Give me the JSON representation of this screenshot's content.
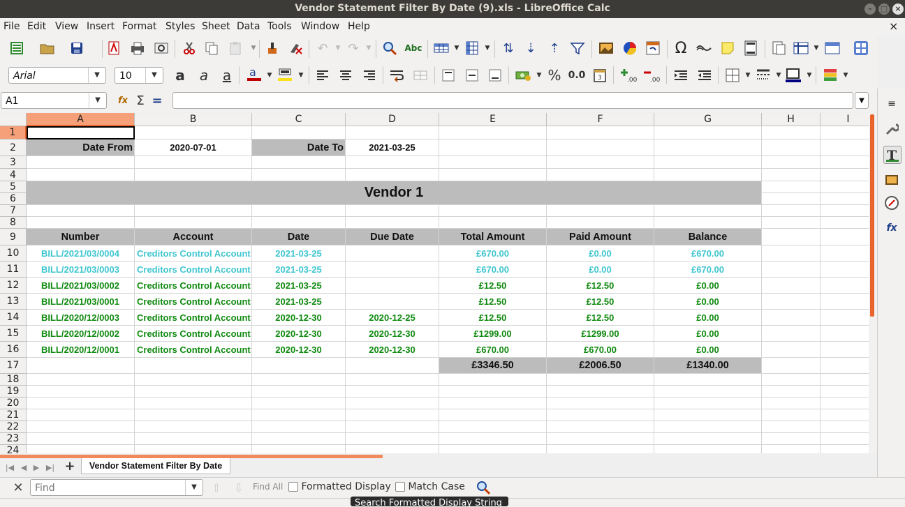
{
  "window": {
    "title": "Vendor Statement Filter By Date (9).xls - LibreOffice Calc",
    "close_glyph": "×"
  },
  "menu": [
    "File",
    "Edit",
    "View",
    "Insert",
    "Format",
    "Styles",
    "Sheet",
    "Data",
    "Tools",
    "Window",
    "Help"
  ],
  "format_bar": {
    "font_name": "Arial",
    "font_size": "10",
    "percent": "%",
    "decimal": "0.0"
  },
  "formula_bar": {
    "name_box": "A1",
    "formula": ""
  },
  "columns": [
    {
      "label": "A"
    },
    {
      "label": "B"
    },
    {
      "label": "C"
    },
    {
      "label": "D"
    },
    {
      "label": "E"
    },
    {
      "label": "F"
    },
    {
      "label": "G"
    },
    {
      "label": "H"
    },
    {
      "label": "I"
    }
  ],
  "rows": [
    "1",
    "2",
    "3",
    "4",
    "5",
    "6",
    "7",
    "8",
    "9",
    "10",
    "11",
    "12",
    "13",
    "14",
    "15",
    "16",
    "17",
    "18",
    "19",
    "20",
    "21",
    "22",
    "23",
    "24"
  ],
  "sheet": {
    "date_from_label": "Date From",
    "date_from": "2020-07-01",
    "date_to_label": "Date To",
    "date_to": "2021-03-25",
    "vendor": "Vendor 1",
    "headers": [
      "Number",
      "Account",
      "Date",
      "Due Date",
      "Total Amount",
      "Paid Amount",
      "Balance"
    ],
    "records": [
      {
        "number": "BILL/2021/03/0004",
        "account": "Creditors Control Account",
        "date": "2021-03-25",
        "due": "",
        "total": "£670.00",
        "paid": "£0.00",
        "balance": "£670.00",
        "color": "#3fc6d0"
      },
      {
        "number": "BILL/2021/03/0003",
        "account": "Creditors Control Account",
        "date": "2021-03-25",
        "due": "",
        "total": "£670.00",
        "paid": "£0.00",
        "balance": "£670.00",
        "color": "#3fc6d0"
      },
      {
        "number": "BILL/2021/03/0002",
        "account": "Creditors Control Account",
        "date": "2021-03-25",
        "due": "",
        "total": "£12.50",
        "paid": "£12.50",
        "balance": "£0.00",
        "color": "#108a10"
      },
      {
        "number": "BILL/2021/03/0001",
        "account": "Creditors Control Account",
        "date": "2021-03-25",
        "due": "",
        "total": "£12.50",
        "paid": "£12.50",
        "balance": "£0.00",
        "color": "#108a10"
      },
      {
        "number": "BILL/2020/12/0003",
        "account": "Creditors Control Account",
        "date": "2020-12-30",
        "due": "2020-12-25",
        "total": "£12.50",
        "paid": "£12.50",
        "balance": "£0.00",
        "color": "#108a10"
      },
      {
        "number": "BILL/2020/12/0002",
        "account": "Creditors Control Account",
        "date": "2020-12-30",
        "due": "2020-12-30",
        "total": "£1299.00",
        "paid": "£1299.00",
        "balance": "£0.00",
        "color": "#108a10"
      },
      {
        "number": "BILL/2020/12/0001",
        "account": "Creditors Control Account",
        "date": "2020-12-30",
        "due": "2020-12-30",
        "total": "£670.00",
        "paid": "£670.00",
        "balance": "£0.00",
        "color": "#108a10"
      }
    ],
    "totals": {
      "total": "£3346.50",
      "paid": "£2006.50",
      "balance": "£1340.00"
    }
  },
  "tabs": {
    "active": "Vendor Statement Filter By Date",
    "add": "+"
  },
  "find_bar": {
    "placeholder": "Find",
    "find_all": "Find All",
    "formatted_display": "Formatted Display",
    "match_case": "Match Case",
    "tooltip": "Search Formatted Display String"
  }
}
